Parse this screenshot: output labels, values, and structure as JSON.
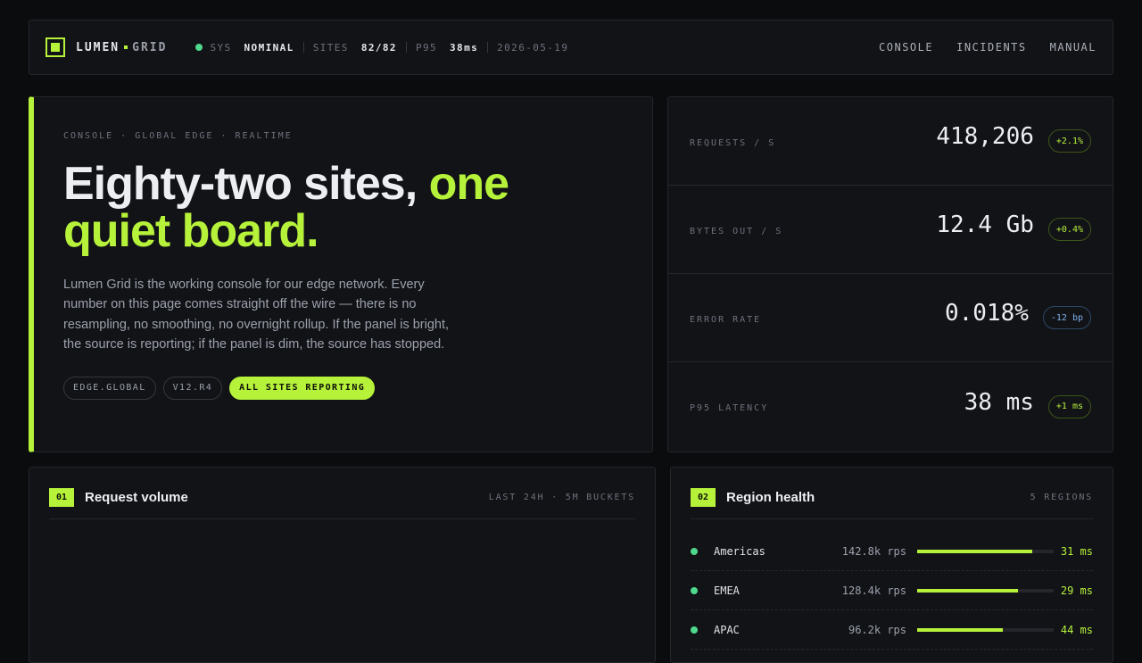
{
  "brand": {
    "name": "LUMEN",
    "name2": "GRID"
  },
  "status": {
    "sys_label": "SYS",
    "sys_value": "NOMINAL",
    "sites_label": "SITES",
    "sites_value": "82/82",
    "p95_label": "P95",
    "p95_value": "38ms",
    "date": "2026-05-19"
  },
  "nav": {
    "console": "CONSOLE",
    "incidents": "INCIDENTS",
    "manual": "MANUAL"
  },
  "hero": {
    "kicker": "CONSOLE · GLOBAL EDGE · REALTIME",
    "headline_plain": "Eighty-two sites, ",
    "headline_accent": "one quiet board.",
    "lede": "Lumen Grid is the working console for our edge network. Every number on this page comes straight off the wire — there is no resampling, no smoothing, no overnight rollup. If the panel is bright, the source is reporting; if the panel is dim, the source has stopped.",
    "chips": [
      "EDGE.GLOBAL",
      "V12.R4",
      "ALL SITES REPORTING"
    ]
  },
  "metrics": [
    {
      "label": "REQUESTS / S",
      "value": "418,206",
      "delta": "+2.1%"
    },
    {
      "label": "BYTES OUT / S",
      "value": "12.4 Gb",
      "delta": "+0.4%"
    },
    {
      "label": "ERROR RATE",
      "value": "0.018%",
      "delta": "-12 bp"
    },
    {
      "label": "P95 LATENCY",
      "value": "38 ms",
      "delta": "+1 ms"
    }
  ],
  "volume": {
    "num": "01",
    "title": "Request volume",
    "meta": "LAST 24H · 5M BUCKETS"
  },
  "regions": {
    "num": "02",
    "title": "Region health",
    "meta": "5 REGIONS",
    "items": [
      {
        "name": "Americas",
        "rps": "142.8k rps",
        "load": 0.84,
        "latency": "31 ms"
      },
      {
        "name": "EMEA",
        "rps": "128.4k rps",
        "load": 0.74,
        "latency": "29 ms"
      },
      {
        "name": "APAC",
        "rps": "96.2k rps",
        "load": 0.63,
        "latency": "44 ms"
      }
    ]
  },
  "colors": {
    "accent": "#b6f23a",
    "ok": "#4fd98c",
    "cool": "#7fb1ea"
  }
}
